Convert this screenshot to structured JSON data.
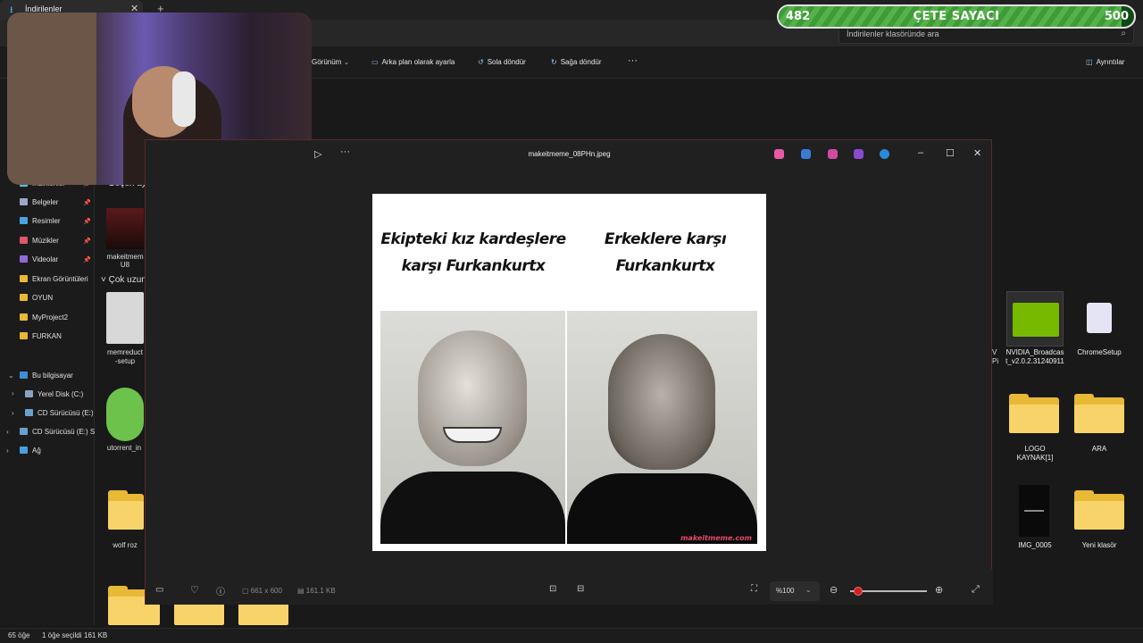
{
  "explorer": {
    "tab_title": "İndirilenler",
    "search_placeholder": "İndirilenler klasöründe ara",
    "toolbar": {
      "view": "Görünüm",
      "set_background": "Arka plan olarak ayarla",
      "rotate_left": "Sola döndür",
      "rotate_right": "Sağa döndür",
      "more": "···",
      "details": "Ayrıntılar"
    },
    "sidebar": {
      "pinned": [
        {
          "label": "İndirilenler",
          "color": "#4fc3f7"
        },
        {
          "label": "Belgeler",
          "color": "#9aa8c8"
        },
        {
          "label": "Resimler",
          "color": "#4aa3df"
        },
        {
          "label": "Müzikler",
          "color": "#e0546d"
        },
        {
          "label": "Videolar",
          "color": "#8e6cd8"
        }
      ],
      "folders": [
        "Ekran Görüntüleri",
        "OYUN",
        "MyProject2",
        "FURKAN"
      ],
      "this_pc": "Bu bilgisayar",
      "drives": [
        "Yerel Disk (C:)",
        "CD Sürücüsü (E:) S",
        "CD Sürücüsü (E:) SF"
      ],
      "network": "Ağ"
    },
    "groups": {
      "recent": "Geçen ay",
      "long_ago": "Çok uzun"
    },
    "files": {
      "f1": "makeitmem",
      "f1b": "U8",
      "f2": "memreduct",
      "f2b": "-setup",
      "f3": "utorrent_in",
      "f4": "wolf roz"
    },
    "status": {
      "items": "65 öğe",
      "selected": "1 öğe seçildi",
      "size": "161 KB"
    }
  },
  "desktop": {
    "icons": [
      {
        "label1": "NVIDIA_Broadcas",
        "label2": "t_v2.0.2.31240911"
      },
      {
        "label1": "ChromeSetup",
        "label2": ""
      },
      {
        "label1": "LOGO",
        "label2": "KAYNAK[1]"
      },
      {
        "label1": "ARA",
        "label2": ""
      },
      {
        "label1": "IMG_0005",
        "label2": ""
      },
      {
        "label1": "Yeni klasör",
        "label2": ""
      }
    ],
    "edge_letters": "V\nPi"
  },
  "counter": {
    "title": "ÇETE SAYACI",
    "min": "482",
    "max": "500",
    "progress": 0.964
  },
  "viewer": {
    "filename": "makeitmeme_08PHn.jpeg",
    "meme": {
      "left_line1": "Ekipteki kız kardeşlere",
      "left_line2": "karşı Furkankurtx",
      "right_line1": "Erkeklere karşı",
      "right_line2": "Furkankurtx",
      "watermark": "makeitmeme.com"
    },
    "info": {
      "dimensions": "661 x 600",
      "filesize": "161.1 KB",
      "zoom": "%100"
    },
    "zoom_slider": 0.1,
    "colors": {
      "accent": "#cc2222",
      "border": "#5a2a2a"
    }
  }
}
